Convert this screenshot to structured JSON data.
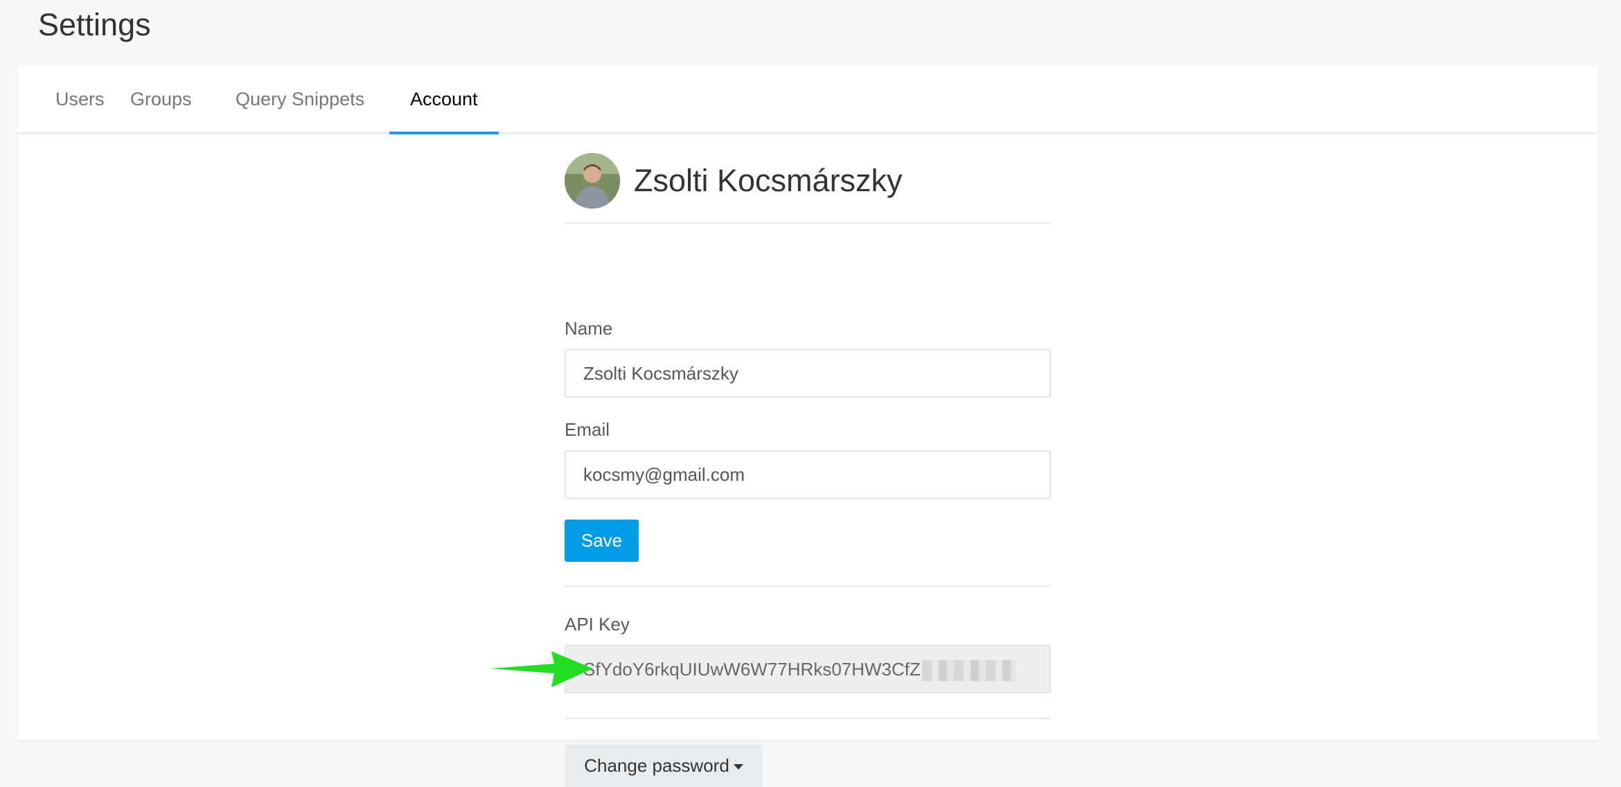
{
  "page": {
    "title": "Settings"
  },
  "tabs": [
    {
      "label": "Users"
    },
    {
      "label": "Groups"
    },
    {
      "label": "Query Snippets"
    },
    {
      "label": "Account",
      "active": true
    }
  ],
  "profile": {
    "name": "Zsolti Kocsmárszky"
  },
  "form": {
    "name_label": "Name",
    "name_value": "Zsolti Kocsmárszky",
    "email_label": "Email",
    "email_value": "kocsmy@gmail.com",
    "save_label": "Save"
  },
  "api_key": {
    "label": "API Key",
    "visible_value": "SfYdoY6rkqUIUwW6W77HRks07HW3CfZ"
  },
  "change_password": {
    "label": "Change password"
  },
  "colors": {
    "accent": "#039be5",
    "active_tab_underline": "#2196f3",
    "annotation_arrow": "#22dd22"
  },
  "icons": {
    "avatar": "user-avatar-photo",
    "caret": "caret-down-icon",
    "annotation": "green-arrow-icon"
  }
}
